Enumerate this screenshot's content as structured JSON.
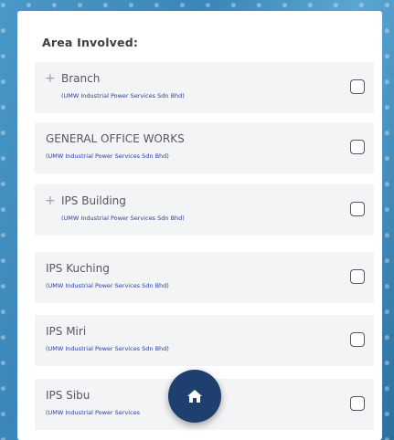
{
  "area_section": {
    "title": "Area Involved:",
    "items": [
      {
        "name": "Branch",
        "sub": "(UMW Industrial Power Services Sdn Bhd)",
        "expandable": true
      },
      {
        "name": "GENERAL OFFICE WORKS",
        "sub": "(UMW Industrial Power Services Sdn Bhd)",
        "expandable": false
      },
      {
        "name": "IPS Building",
        "sub": "(UMW Industrial Power Services Sdn Bhd)",
        "expandable": true
      },
      {
        "name": "IPS Kuching",
        "sub": "(UMW Industrial Power Services Sdn Bhd)",
        "expandable": false
      },
      {
        "name": "IPS Miri",
        "sub": "(UMW Industrial Power Services Sdn Bhd)",
        "expandable": false
      },
      {
        "name": "IPS Sibu",
        "sub": "(UMW Industrial Power Services",
        "expandable": false
      }
    ]
  },
  "icons": {
    "expand": "plus-icon",
    "checkbox": "checkbox-unchecked-icon",
    "fab": "home-icon"
  },
  "colors": {
    "fab_bg": "#1f3f6e",
    "subtitle": "#2a3f9e",
    "item_bg": "#f3f4f5"
  }
}
